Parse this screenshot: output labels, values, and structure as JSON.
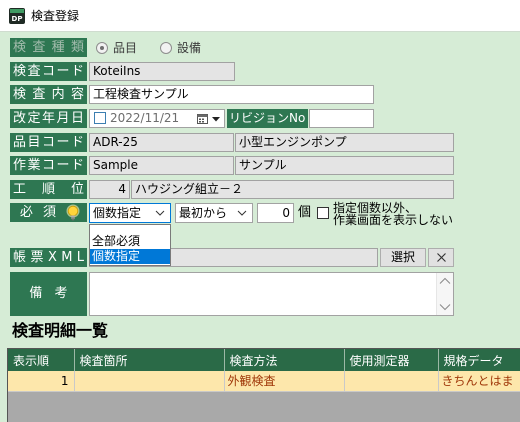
{
  "window": {
    "title": "検査登録",
    "icon": "app-logo-icon",
    "logo_text": "DP"
  },
  "form": {
    "inspection_type": {
      "label": "検 査 種 類",
      "enabled": false,
      "options": [
        {
          "label": "品目",
          "selected": true
        },
        {
          "label": "設備",
          "selected": false
        }
      ]
    },
    "inspection_code": {
      "label": "検査コード",
      "value": "KoteiIns"
    },
    "inspection_content": {
      "label": "検 査 内 容",
      "value": "工程検査サンプル"
    },
    "revision_date": {
      "label": "改定年月日",
      "checked": false,
      "value": "2022/11/21",
      "calendar_icon": "calendar-icon",
      "dropdown_icon": "dropdown-arrow-icon"
    },
    "revision_no": {
      "label": "リビジョンNo",
      "value": ""
    },
    "item_code": {
      "label": "品目コード",
      "code": "ADR-25",
      "name": "小型エンジンポンプ"
    },
    "work_code": {
      "label": "作業コード",
      "code": "Sample",
      "name": "サンプル"
    },
    "process_order": {
      "label": "工 順 位",
      "number": "4",
      "name": "ハウジング組立－２"
    },
    "required": {
      "label": "必 須",
      "hint_icon": "lightbulb-icon",
      "mode": "個数指定",
      "mode_dropdown_open": true,
      "mode_options": [
        "全部必須",
        "個数指定"
      ],
      "mode_highlighted_index": 1,
      "start": "最初から",
      "count": "0",
      "count_unit": "個",
      "hide_others_checked": false,
      "hide_others_line1": "指定個数以外、",
      "hide_others_line2": "作業画面を表示しない"
    },
    "report_xml": {
      "label": "帳 票 X M L",
      "value": "",
      "select_button": "選択",
      "clear_icon": "close-icon"
    },
    "remarks": {
      "label": "備 考",
      "value": "",
      "scroll_up_icon": "chevron-up-icon",
      "scroll_down_icon": "chevron-down-icon"
    }
  },
  "details": {
    "heading": "検査明細一覧",
    "columns": [
      "表示順",
      "検査箇所",
      "検査方法",
      "使用測定器",
      "規格データ"
    ],
    "rows": [
      {
        "order": "1",
        "location": "",
        "method": "外観検査",
        "instrument": "",
        "spec": "きちんとはま"
      }
    ]
  },
  "colors": {
    "body_bg": "#d6ecd6",
    "label_bg": "#2e7752",
    "header_bg": "#2a6a47",
    "row_bg": "#fde7ab",
    "row_text": "#a0380a",
    "highlight": "#0078d7"
  }
}
